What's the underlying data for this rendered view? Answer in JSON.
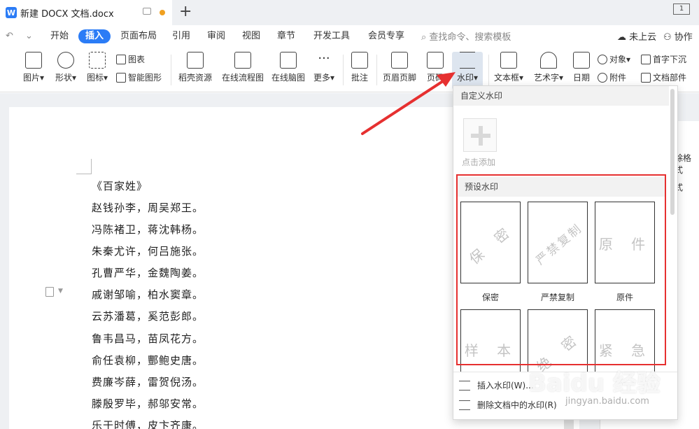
{
  "titlebar": {
    "logo": "W",
    "doc_title": "新建 DOCX 文档.docx",
    "new_tab": "+",
    "page_badge": "1"
  },
  "menubar": {
    "quick_icons": [
      "↶",
      "⌄"
    ],
    "items": [
      "开始",
      "插入",
      "页面布局",
      "引用",
      "审阅",
      "视图",
      "章节",
      "开发工具",
      "会员专享"
    ],
    "active": "插入",
    "search_hint": "查找命令、搜索模板",
    "cloud": "未上云",
    "collab": "协作"
  },
  "ribbon": {
    "picture": "图片",
    "shape": "形状",
    "icon": "图标",
    "chart": "图表",
    "smart_graphic": "智能图形",
    "resources": "稻壳资源",
    "flowchart": "在线流程图",
    "mindmap": "在线脑图",
    "more": "更多",
    "comment": "批注",
    "header_footer": "页眉页脚",
    "page_number": "页码",
    "watermark": "水印",
    "textbox": "文本框",
    "wordart": "艺术字",
    "date": "日期",
    "object": "对象",
    "attachment": "附件",
    "dropcap": "首字下沉",
    "doc_parts": "文档部件"
  },
  "document": {
    "lines": [
      "《百家姓》",
      "赵钱孙李，周吴郑王。",
      "冯陈褚卫，蒋沈韩杨。",
      "朱秦尤许，何吕施张。",
      "孔曹严华，金魏陶姜。",
      "戚谢邹喻，柏水窦章。",
      "云苏潘葛，奚范彭郎。",
      "鲁韦昌马，苗凤花方。",
      "俞任袁柳，酆鲍史唐。",
      "费廉岑薛，雷贺倪汤。",
      "滕殷罗毕，郝邬安常。",
      "乐于时傅，皮卞齐康。"
    ]
  },
  "right_panel": {
    "text1": "除格式",
    "text2": "式"
  },
  "watermark_menu": {
    "custom_title": "自定义水印",
    "add_label": "点击添加",
    "preset_title": "预设水印",
    "presets": [
      {
        "text": "保 密",
        "caption": "保密"
      },
      {
        "text": "严禁复制",
        "caption": "严禁复制"
      },
      {
        "text": "原 件",
        "caption": "原件"
      },
      {
        "text": "样 本",
        "caption": ""
      },
      {
        "text": "绝 密",
        "caption": ""
      },
      {
        "text": "紧 急",
        "caption": ""
      }
    ],
    "insert_action": "插入水印(W)...",
    "delete_action": "删除文档中的水印(R)"
  },
  "overlay": {
    "baidu": "Baidu 经验",
    "site": "jingyan.baidu.com"
  },
  "colors": {
    "accent": "#2b7cf6",
    "highlight_box": "#e63030",
    "arrow": "#e63030"
  }
}
